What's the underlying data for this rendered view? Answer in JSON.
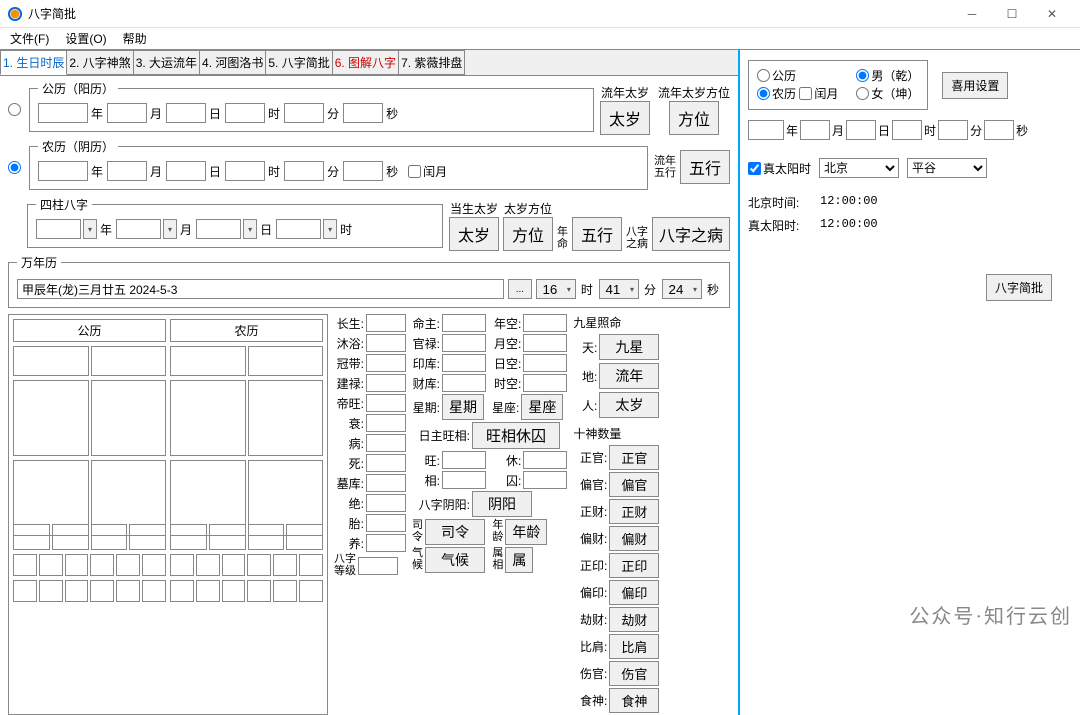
{
  "app": {
    "title": "八字简批"
  },
  "menu": {
    "file": "文件(F)",
    "settings": "设置(O)",
    "help": "帮助"
  },
  "tabs": [
    "1. 生日时辰",
    "2. 八字神煞",
    "3. 大运流年",
    "4. 河图洛书",
    "5. 八字简批",
    "6. 图解八字",
    "7. 紫薇排盘"
  ],
  "fs_gl": {
    "legend": "公历（阳历）",
    "y": "年",
    "m": "月",
    "d": "日",
    "h": "时",
    "min": "分",
    "s": "秒"
  },
  "fs_nl": {
    "legend": "农历（阴历）",
    "y": "年",
    "m": "月",
    "d": "日",
    "h": "时",
    "min": "分",
    "s": "秒",
    "leap": "闰月"
  },
  "fs_bz": {
    "legend": "四柱八字",
    "y": "年",
    "m": "月",
    "d": "日",
    "h": "时"
  },
  "side1": {
    "l1": "流年太岁",
    "b1": "太岁",
    "l2": "流年太岁方位",
    "b2": "方位"
  },
  "side2": {
    "l1": "流年",
    "l2": "五行",
    "b1": "五行"
  },
  "side3": {
    "l1": "当生太岁",
    "b1": "太岁",
    "l2": "太岁方位",
    "b2": "方位",
    "l3": "年",
    "l4": "命",
    "b3": "五行",
    "l5": "八字",
    "l6": "之病",
    "b4": "八字之病"
  },
  "wan": {
    "legend": "万年历",
    "value": "甲辰年(龙)三月廿五 2024-5-3",
    "h_v": "16",
    "h": "时",
    "m_v": "41",
    "m": "分",
    "s_v": "24",
    "s": "秒"
  },
  "cal": {
    "h1": "公历",
    "h2": "农历"
  },
  "life": [
    "长生:",
    "沐浴:",
    "冠带:",
    "建禄:",
    "帝旺:",
    "衰:",
    "病:",
    "死:",
    "墓库:",
    "绝:",
    "胎:",
    "养:"
  ],
  "life_tail": {
    "k": "八字",
    "k2": "等级"
  },
  "mid": {
    "mz": "命主:",
    "nk": "年空:",
    "gl": "官禄:",
    "yk": "月空:",
    "yk2": "印库:",
    "rk": "日空:",
    "ck": "财库:",
    "sk": "时空:",
    "xq": "星期:",
    "xq_b": "星期",
    "xz": "星座:",
    "xz_b": "星座",
    "rw": "日主旺相:",
    "rw_b": "旺相休囚",
    "wang": "旺:",
    "xiu": "休:",
    "xiang": "相:",
    "qiu": "囚:",
    "yy": "八字阴阳:",
    "yy_b": "阴阳",
    "sl": "司",
    "sl2": "令",
    "sl_b": "司令",
    "nl": "年",
    "nl2": "龄",
    "nl_b": "年龄",
    "qh": "气",
    "qh2": "候",
    "qh_b": "气候",
    "sx": "属",
    "sx2": "相",
    "sx_b": "属"
  },
  "nine": {
    "title": "九星照命",
    "t": "天:",
    "t_b": "九星",
    "d": "地:",
    "d_b": "流年",
    "r": "人:",
    "r_b": "太岁"
  },
  "ten": {
    "title": "十神数量",
    "items": [
      {
        "k": "正官:",
        "b": "正官"
      },
      {
        "k": "偏官:",
        "b": "偏官"
      },
      {
        "k": "正财:",
        "b": "正财"
      },
      {
        "k": "偏财:",
        "b": "偏财"
      },
      {
        "k": "正印:",
        "b": "正印"
      },
      {
        "k": "偏印:",
        "b": "偏印"
      },
      {
        "k": "劫财:",
        "b": "劫财"
      },
      {
        "k": "比肩:",
        "b": "比肩"
      },
      {
        "k": "伤官:",
        "b": "伤官"
      },
      {
        "k": "食神:",
        "b": "食神"
      }
    ]
  },
  "right": {
    "gl": "公历",
    "nl": "农历",
    "leap": "闰月",
    "male": "男（乾）",
    "female": "女（坤）",
    "pref": "喜用设置",
    "y": "年",
    "m": "月",
    "d": "日",
    "h": "时",
    "min": "分",
    "s": "秒",
    "true_sun": "真太阳时",
    "city": "北京",
    "district": "平谷",
    "bj": "北京时间:",
    "bj_v": "12:00:00",
    "ts": "真太阳时:",
    "ts_v": "12:00:00",
    "run": "八字简批"
  },
  "watermark": "公众号·知行云创"
}
